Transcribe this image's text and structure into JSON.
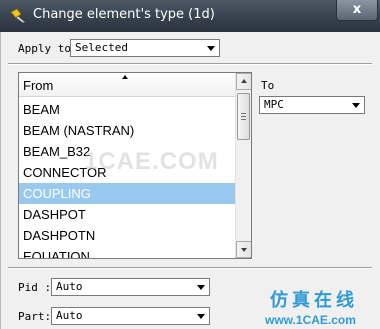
{
  "window": {
    "title": "Change element's type (1d)",
    "close_label": "x",
    "title_icon": "tool-icon"
  },
  "apply_to": {
    "label": "Apply to",
    "value": "Selected"
  },
  "from_list": {
    "header": "From",
    "items": [
      "BEAM",
      "BEAM (NASTRAN)",
      "BEAM_B32",
      "CONNECTOR",
      "COUPLING",
      "DASHPOT",
      "DASHPOTN",
      "EQUATION"
    ],
    "selected": "COUPLING"
  },
  "to": {
    "label": "To",
    "value": "MPC"
  },
  "pid": {
    "label": "Pid :",
    "value": "Auto"
  },
  "part": {
    "label": "Part:",
    "value": "Auto"
  },
  "watermark": {
    "center_text": "1CAE.COM",
    "brand_cn": "仿真在线",
    "url": "www.1CAE.com"
  },
  "colors": {
    "selection": "#99c9ef",
    "titlebar": "#3a4552",
    "watermark_blue": "#2e9bd6"
  }
}
